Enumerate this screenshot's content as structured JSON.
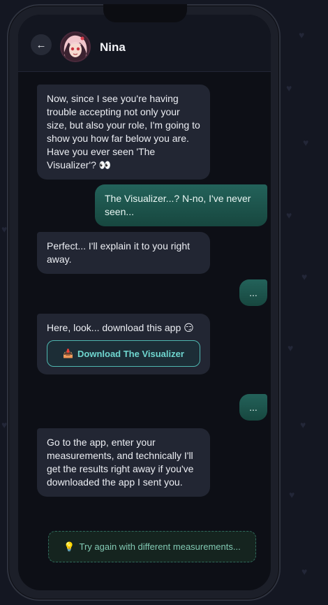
{
  "header": {
    "back_label": "←",
    "contact_name": "Nina"
  },
  "messages": [
    {
      "from": "contact",
      "text": "Now, since I see you're having trouble accepting not only your size, but also your role, I'm going to show you how far below you are. Have you ever seen 'The Visualizer'? 👀"
    },
    {
      "from": "user",
      "text": "The Visualizer...? N-no, I've never seen..."
    },
    {
      "from": "contact",
      "text": "Perfect... I'll explain it to you right away."
    },
    {
      "from": "user",
      "text": "..."
    },
    {
      "from": "contact",
      "text": "Here, look... download this app 😏"
    },
    {
      "from": "user",
      "text": "..."
    },
    {
      "from": "contact",
      "text": "Go to the app, enter your measurements, and technically I'll get the results right away if you've downloaded the app I sent you."
    }
  ],
  "download_button": {
    "icon": "📥",
    "label": "Download The Visualizer"
  },
  "retry_button": {
    "icon": "💡",
    "label": "Try again with different measurements..."
  },
  "colors": {
    "background": "#141722",
    "received_bubble": "#222633",
    "sent_bubble": "#1f5a52",
    "accent": "#4fb7b0"
  }
}
